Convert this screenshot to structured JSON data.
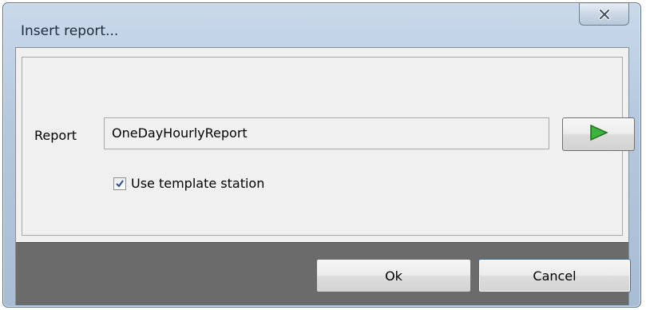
{
  "window": {
    "title": "Insert report...",
    "close_icon": "close-x-icon"
  },
  "form": {
    "report_label": "Report",
    "report_value": "OneDayHourlyReport",
    "run_icon": "play-triangle-icon",
    "run_icon_color": "#2ea52e",
    "use_template_label": "Use template station",
    "use_template_checked": true
  },
  "buttons": {
    "ok_label": "Ok",
    "cancel_label": "Cancel"
  }
}
